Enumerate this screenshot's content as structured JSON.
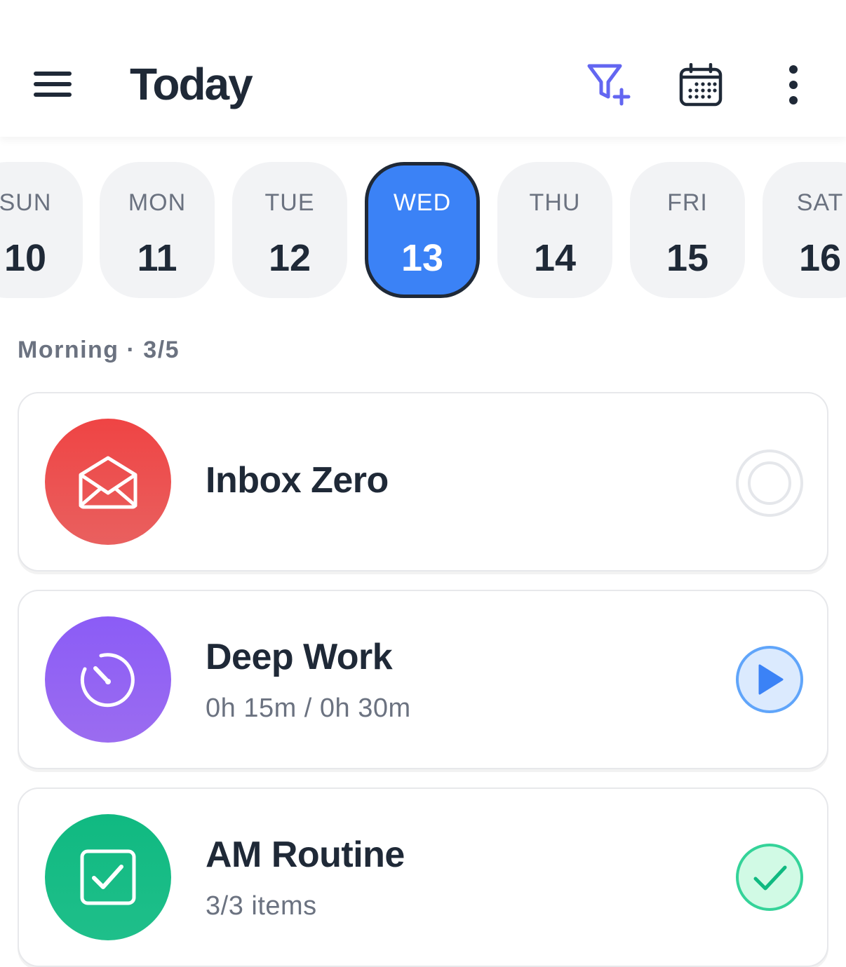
{
  "header": {
    "title": "Today",
    "icons": [
      "menu-icon",
      "filter-add-icon",
      "calendar-icon",
      "more-vertical-icon"
    ],
    "accent_color": "#6366f1"
  },
  "days": [
    {
      "name": "SUN",
      "date": "10"
    },
    {
      "name": "MON",
      "date": "11"
    },
    {
      "name": "TUE",
      "date": "12"
    },
    {
      "name": "WED",
      "date": "13",
      "selected": true
    },
    {
      "name": "THU",
      "date": "14"
    },
    {
      "name": "FRI",
      "date": "15"
    },
    {
      "name": "SAT",
      "date": "16"
    }
  ],
  "section": {
    "label": "Morning · 3/5"
  },
  "habits": [
    {
      "title": "Inbox Zero",
      "subtitle": "",
      "icon": "envelope-open-icon",
      "color": "#ef4444",
      "status": "not-started"
    },
    {
      "title": "Deep Work",
      "subtitle": "0h 15m / 0h 30m",
      "icon": "timer-icon",
      "color": "#8b5cf6",
      "status": "in-progress",
      "progress": 0.5
    },
    {
      "title": "AM Routine",
      "subtitle": "3/3 items",
      "icon": "checklist-icon",
      "color": "#10b981",
      "status": "completed"
    }
  ],
  "colors": {
    "selected_day": "#3b82f6",
    "day_bg": "#f2f3f5",
    "text_primary": "#1f2937",
    "text_secondary": "#6b7280"
  }
}
